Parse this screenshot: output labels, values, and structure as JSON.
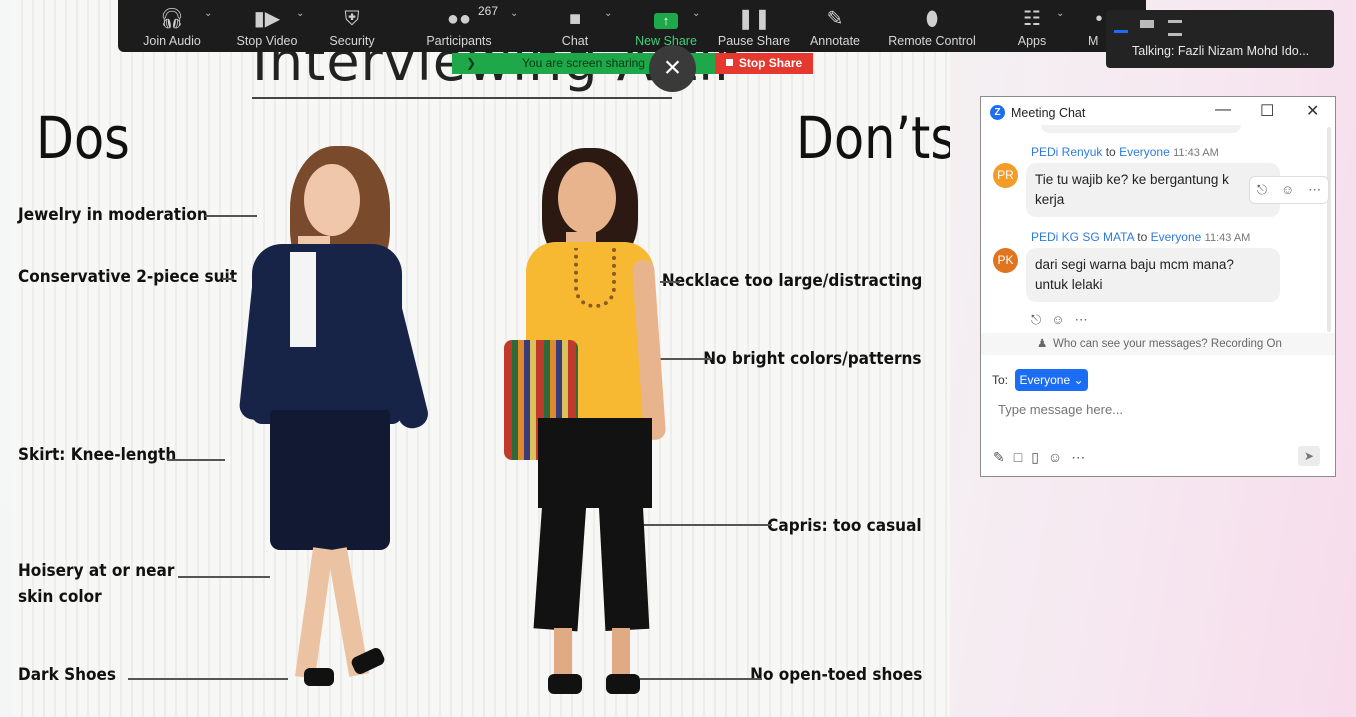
{
  "toolbar": {
    "items": [
      {
        "label": "Join Audio",
        "icon": "headphones-icon"
      },
      {
        "label": "Stop Video",
        "icon": "video-camera-icon"
      },
      {
        "label": "Security",
        "icon": "shield-icon"
      },
      {
        "label": "Participants",
        "icon": "people-icon",
        "count": "267"
      },
      {
        "label": "Chat",
        "icon": "chat-bubble-icon"
      },
      {
        "label": "New Share",
        "icon": "share-arrow-icon"
      },
      {
        "label": "Pause Share",
        "icon": "pause-icon"
      },
      {
        "label": "Annotate",
        "icon": "pencil-icon"
      },
      {
        "label": "Remote Control",
        "icon": "mouse-icon"
      },
      {
        "label": "Apps",
        "icon": "apps-icon"
      },
      {
        "label": "M",
        "icon": "more-icon"
      }
    ]
  },
  "share_banner": {
    "text": "You are screen sharing",
    "stop_label": "Stop Share"
  },
  "talking": {
    "text": "Talking: Fazli Nizam Mohd Ido..."
  },
  "slide": {
    "title": "Interviewing Attir",
    "dos_heading": "Dos",
    "donts_heading": "Don’ts",
    "dos": [
      "Jewelry in moderation",
      "Conservative 2-piece suit",
      "Skirt: Knee-length",
      "Hoisery at or near",
      "skin color",
      "Dark Shoes"
    ],
    "donts": [
      "Necklace too large/distracting",
      "No bright colors/patterns",
      "Capris: too casual",
      "No open-toed shoes"
    ]
  },
  "chat": {
    "title": "Meeting Chat",
    "messages": [
      {
        "initials": "PR",
        "sender": "PEDi Renyuk",
        "to_word": "to",
        "recipient": "Everyone",
        "time": "11:43 AM",
        "line1": "Tie tu wajib ke? ke bergantung k",
        "line2": "kerja",
        "avatar_color": "#f39c27"
      },
      {
        "initials": "PK",
        "sender": "PEDi KG SG MATA",
        "to_word": "to",
        "recipient": "Everyone",
        "time": "11:43 AM",
        "line1": "dari segi warna baju mcm mana?",
        "line2": "untuk lelaki",
        "avatar_color": "#e0751f"
      }
    ],
    "privacy": "Who can see your messages? Recording On",
    "to_label": "To:",
    "recipient_button": "Everyone",
    "input_placeholder": "Type message here..."
  },
  "colors": {
    "accent": "#1b6ef3",
    "share_green": "#1ea84a",
    "stop_red": "#e5382e"
  }
}
